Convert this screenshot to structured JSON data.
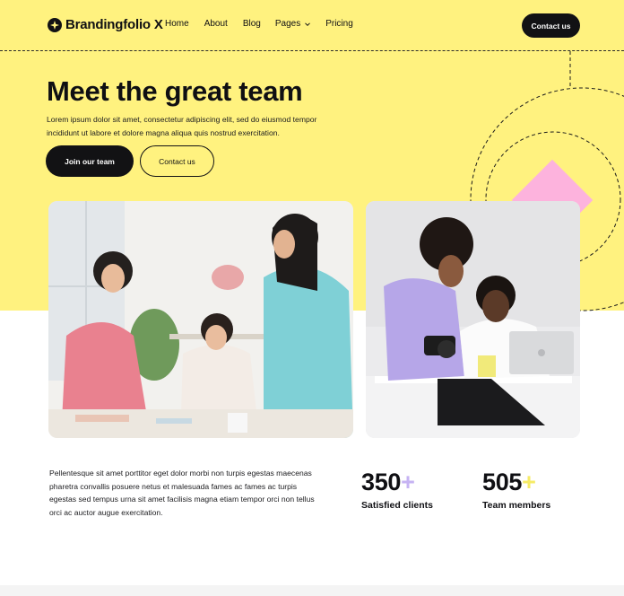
{
  "brand": {
    "name": "Brandingfolio X"
  },
  "nav": {
    "items": [
      {
        "label": "Home"
      },
      {
        "label": "About"
      },
      {
        "label": "Blog"
      },
      {
        "label": "Pages"
      },
      {
        "label": "Pricing"
      }
    ],
    "cta_label": "Contact us"
  },
  "hero": {
    "title": "Meet the great team",
    "subtitle": "Lorem ipsum dolor sit amet, consectetur adipiscing elit, sed do eiusmod tempor incididunt ut labore et dolore magna aliqua quis nostrud exercitation.",
    "primary_button": "Join our team",
    "secondary_button": "Contact us"
  },
  "about": {
    "text": "Pellentesque sit amet porttitor eget dolor morbi non turpis egestas maecenas pharetra convallis posuere netus et malesuada fames ac fames ac turpis egestas sed tempus urna sit amet facilisis magna etiam tempor orci non tellus orci ac auctor augue exercitation."
  },
  "stats": [
    {
      "value": "350",
      "suffix": "+",
      "label": "Satisfied clients"
    },
    {
      "value": "505",
      "suffix": "+",
      "label": "Team members"
    }
  ],
  "colors": {
    "hero_background": "#fff27f",
    "dark": "#121214",
    "accent_pink": "#fdb3dd",
    "accent_purple": "#c6b3f3",
    "accent_yellow": "#f6eb66"
  },
  "icons": {
    "logo": "sparkle-star-icon",
    "dropdown": "chevron-down-icon"
  }
}
